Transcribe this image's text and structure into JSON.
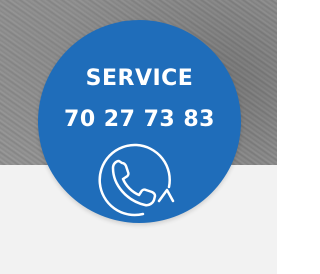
{
  "service": {
    "title": "SERVICE",
    "phone_number": "70 27 73 83",
    "icon": "phone-callback-icon"
  },
  "colors": {
    "badge_blue": "#1f6dba",
    "text": "#ffffff",
    "band": "#f2f2f2"
  }
}
